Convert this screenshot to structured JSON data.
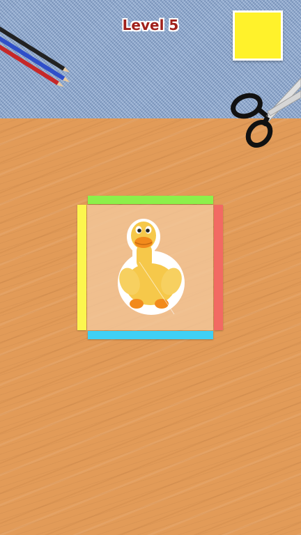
{
  "hud": {
    "level_label": "Level 5"
  },
  "target_swatch": {
    "color": "#fff22b"
  },
  "board": {
    "strips": {
      "top_color": "#8cf04a",
      "bottom_color": "#3fd0f5",
      "left_color": "#fcf64e",
      "right_color": "#f26a63"
    },
    "sticker": {
      "icon": "duck-sticker-icon"
    }
  },
  "decor": {
    "pencils_icon": "colored-pencils-icon",
    "scissors_icon": "scissors-icon",
    "background_top": "denim-cloth",
    "background_bottom": "wooden-desk"
  }
}
